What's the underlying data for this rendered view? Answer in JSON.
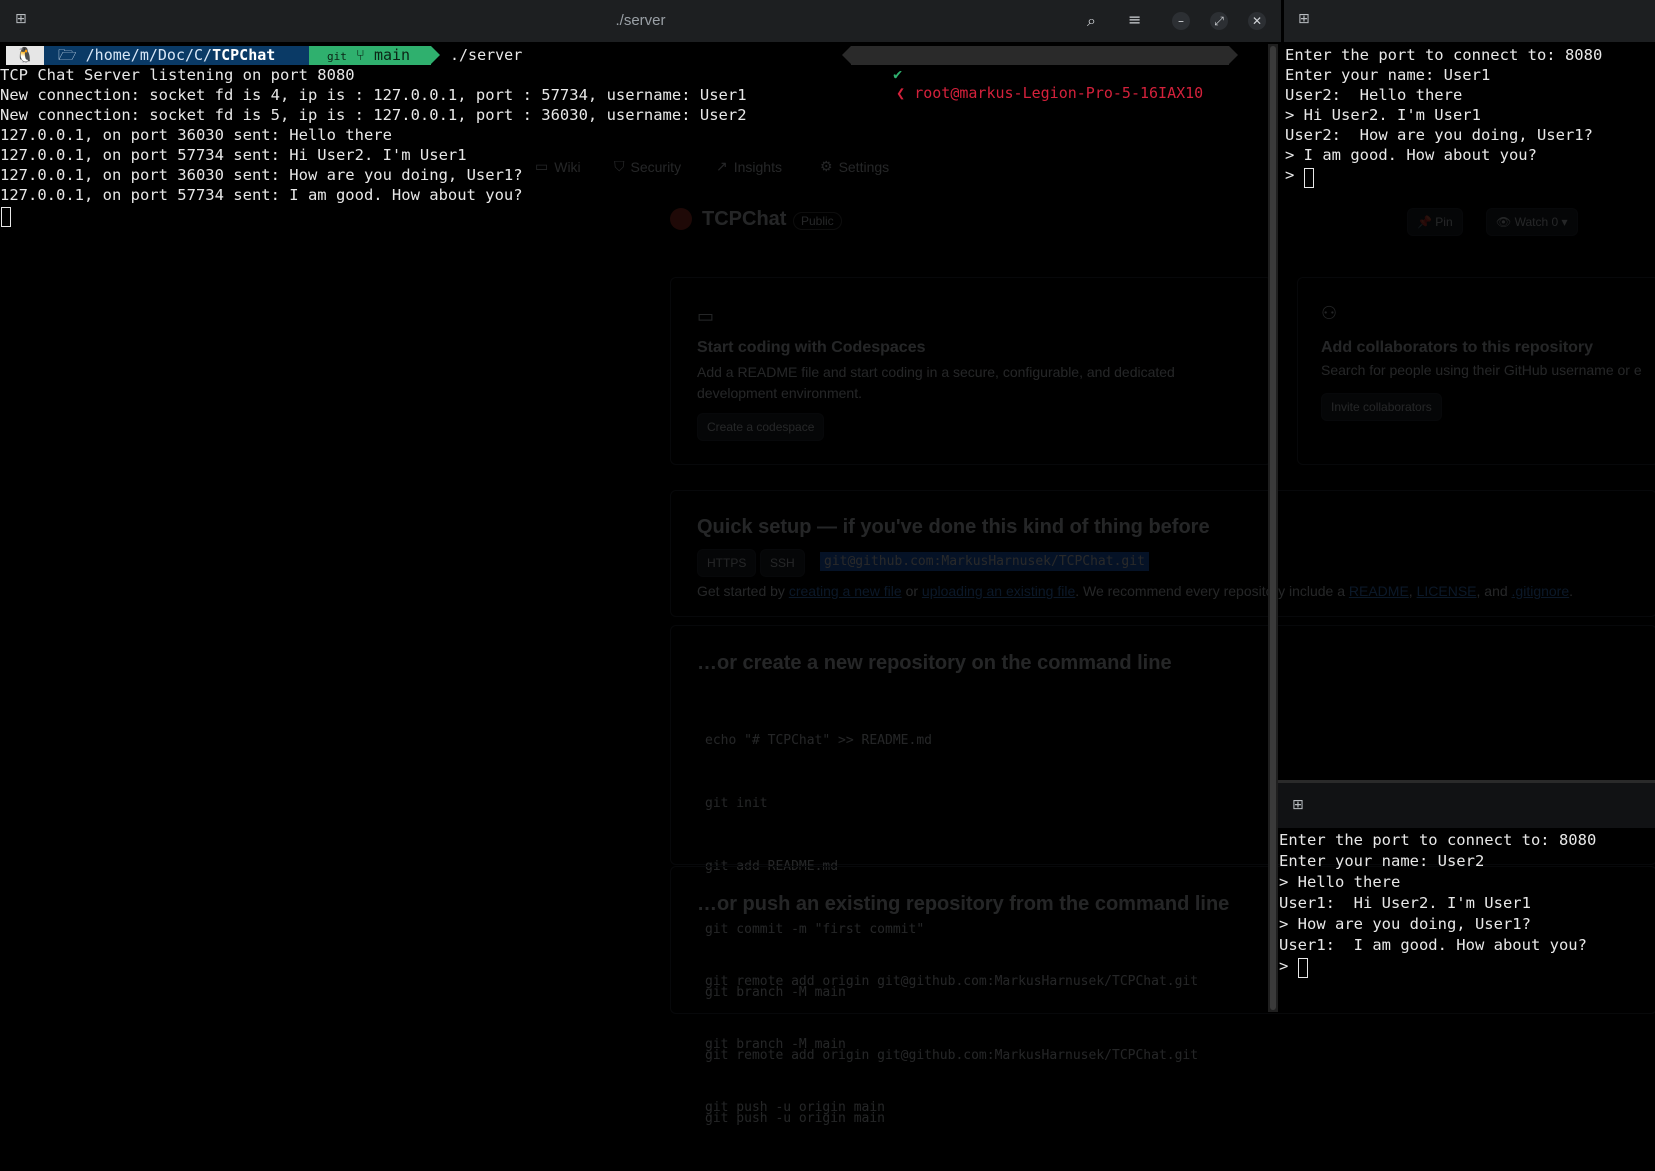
{
  "window": {
    "title": "./server",
    "buttons": [
      "search",
      "menu",
      "minimize",
      "maximize",
      "close"
    ]
  },
  "prompt": {
    "os_icon": "linux-tux-icon",
    "path_prefix": "/home/m/Doc/C/",
    "path_dir": "TCPChat",
    "git_label": "git",
    "branch": "main",
    "command": "./server",
    "status_check": "✔",
    "user_host": "root@markus-Legion-Pro-5-16IAX10"
  },
  "server_output": [
    "TCP Chat Server listening on port 8080",
    "New connection: socket fd is 4, ip is : 127.0.0.1, port : 57734, username: User1",
    "New connection: socket fd is 5, ip is : 127.0.0.1, port : 36030, username: User2",
    "127.0.0.1, on port 36030 sent: Hello there",
    "127.0.0.1, on port 57734 sent: Hi User2. I'm User1",
    "127.0.0.1, on port 36030 sent: How are you doing, User1?",
    "127.0.0.1, on port 57734 sent: I am good. How about you?"
  ],
  "client1_output": [
    "Enter the port to connect to: 8080",
    "Enter your name: User1",
    "User2:  Hello there",
    "> Hi User2. I'm User1",
    "User2:  How are you doing, User1?",
    "> I am good. How about you?",
    "> "
  ],
  "client2_output": [
    "Enter the port to connect to: 8080",
    "Enter your name: User2",
    "> Hello there",
    "User1:  Hi User2. I'm User1",
    "> How are you doing, User1?",
    "User1:  I am good. How about you?",
    "> "
  ],
  "ghost_github": {
    "tabs": [
      "Wiki",
      "Security",
      "Insights",
      "Settings"
    ],
    "repo_name": "TCPChat",
    "visibility": "Public",
    "pin_label": "Pin",
    "watch_label": "Watch",
    "watch_count": "0",
    "codespaces_title": "Start coding with Codespaces",
    "codespaces_desc": "Add a README file and start coding in a secure, configurable, and dedicated development environment.",
    "codespaces_button": "Create a codespace",
    "collab_title": "Add collaborators to this repository",
    "collab_desc": "Search for people using their GitHub username or e",
    "collab_button": "Invite collaborators",
    "quick_setup_title": "Quick setup — if you've done this kind of thing before",
    "proto_https": "HTTPS",
    "proto_ssh": "SSH",
    "clone_url": "git@github.com:MarkusHarnusek/TCPChat.git",
    "getting_started_prefix": "Get started by",
    "link_new_file": "creating a new file",
    "or_text": "or",
    "link_upload": "uploading an existing file",
    "recommend_text": ". We recommend every repository include a",
    "link_readme": "README",
    "link_license": "LICENSE",
    "and_text": ", and",
    "link_gitignore": ".gitignore",
    "create_new_title": "…or create a new repository on the command line",
    "create_new_cmds": [
      "echo \"# TCPChat\" >> README.md",
      "git init",
      "git add README.md",
      "git commit -m \"first commit\"",
      "git branch -M main",
      "git remote add origin git@github.com:MarkusHarnusek/TCPChat.git",
      "git push -u origin main"
    ],
    "push_existing_title": "…or push an existing repository from the command line",
    "push_existing_cmds": [
      "git remote add origin git@github.com:MarkusHarnusek/TCPChat.git",
      "git branch -M main",
      "git push -u origin main"
    ]
  }
}
